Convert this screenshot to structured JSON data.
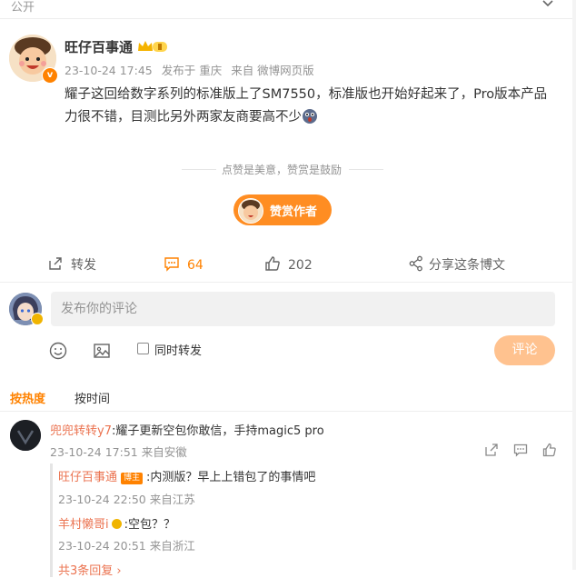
{
  "header": {
    "visibility": "公开"
  },
  "post": {
    "author": "旺仔百事通",
    "time": "23-10-24 17:45",
    "location": "发布于 重庆",
    "source": "来自 微博网页版",
    "text": "耀子这回给数字系列的标准版上了SM7550，标准版也开始好起来了，Pro版本产品力很不错，目测比另外两家友商要高不少",
    "reward_tip": "点赞是美意，赞赏是鼓励",
    "reward_button": "赞赏作者",
    "actions": {
      "repost": "转发",
      "comments": "64",
      "likes": "202",
      "share": "分享这条博文"
    }
  },
  "composer": {
    "placeholder": "发布你的评论",
    "repost_label": "同时转发",
    "submit": "评论"
  },
  "sort": {
    "hot": "按热度",
    "time": "按时间"
  },
  "comments": [
    {
      "user": "兜兜转转y7",
      "text": ":耀子更新空包你敢信，手持magic5 pro",
      "time": "23-10-24 17:51",
      "source": "来自安徽",
      "replies": [
        {
          "user": "旺仔百事通",
          "tag": "博主",
          "text": ":内测版？早上上错包了的事情吧",
          "time": "23-10-24 22:50",
          "source": "来自江苏"
        },
        {
          "user": "羊村懒哥i",
          "text": ":空包？？",
          "time": "23-10-24 20:51",
          "source": "来自浙江"
        }
      ],
      "more_replies": "共3条回复 ›"
    }
  ],
  "colors": {
    "accent": "#ff8200",
    "username_link": "#eb7350",
    "meta": "#939393"
  }
}
